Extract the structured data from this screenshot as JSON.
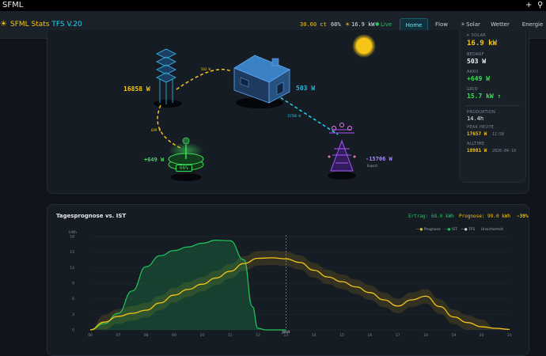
{
  "window": {
    "title": "SFML",
    "plus": "+",
    "search_glyph": "⚲"
  },
  "nav": {
    "brand_a": "SFML Stats",
    "brand_b": "TFS V.20",
    "price": "30.60 ct",
    "percent": "66%",
    "solar_now": "16.9 kW",
    "live": "Live",
    "items": [
      "Home",
      "Flow",
      "Solar",
      "Wetter",
      "Energie"
    ]
  },
  "flow": {
    "solar_panel": "16858 W",
    "house": "503 W",
    "grid": "-15706 W",
    "grid_sub": "Export",
    "battery": "+649 W",
    "battery_soc": "66%",
    "line_solar_house": "503 W",
    "line_house_grid": "15706 W",
    "line_solar_batt": "649 W"
  },
  "stats": {
    "solar_label": "SOLAR",
    "solar_value": "16.9 kW",
    "bedarf_label": "BEDARF",
    "bedarf_value": "503 W",
    "akku_label": "AKKU",
    "akku_value": "+649 W",
    "grid_label": "GRID",
    "grid_value": "15.7 kW ↑",
    "prod_label": "PRODUKTION",
    "prod_value": "14.4h",
    "peak_label": "PEAK HEUTE",
    "peak_value": "17657 W",
    "peak_time": "11:58",
    "alltime_label": "ALLTIME",
    "alltime_value": "18981 W",
    "alltime_date": "2026-04-19"
  },
  "forecast": {
    "title": "Tagesprognose vs. IST",
    "ertrag": "Ertrag: 68.0 kWh",
    "prognose": "Prognose: 99.0 kWh",
    "delta": "-39%",
    "legend": [
      "Prognose",
      "IST",
      "TFS",
      "Unsicherheit"
    ]
  },
  "colors": {
    "solar": "#f5c518",
    "house": "#22b8e6",
    "battery": "#3ddc5a",
    "grid": "#a78bfa",
    "prognose": "#f5c518",
    "ist": "#22c55e"
  },
  "chart_data": {
    "type": "line",
    "ylabel": "kWh",
    "ylim": [
      0,
      18
    ],
    "y_ticks": [
      "0",
      "3",
      "6",
      "9",
      "12",
      "15",
      "18"
    ],
    "x_ticks": [
      "06",
      "07",
      "08",
      "09",
      "10",
      "11",
      "12",
      "13",
      "14",
      "15",
      "16",
      "17",
      "18",
      "19",
      "20",
      "21"
    ],
    "now_marker": {
      "x": 13.0,
      "label": "Jetzt"
    },
    "series": [
      {
        "name": "Prognose",
        "x": [
          6,
          6.5,
          7,
          7.5,
          8,
          8.5,
          9,
          9.5,
          10,
          10.5,
          11,
          11.5,
          12,
          12.5,
          13,
          13.5,
          14,
          14.5,
          15,
          15.5,
          16,
          16.5,
          17,
          17.5,
          18,
          18.5,
          19,
          19.5,
          20,
          20.5,
          21
        ],
        "y": [
          0,
          1.5,
          2.6,
          3.2,
          3.8,
          5.2,
          6.7,
          7.8,
          8.8,
          10,
          11.3,
          12.8,
          13.8,
          13.9,
          13.7,
          13.0,
          11.5,
          10.2,
          9.3,
          8.3,
          7.2,
          5.8,
          4.6,
          5.8,
          6.5,
          4.5,
          2.5,
          1.4,
          0.6,
          0.3,
          0.1
        ]
      },
      {
        "name": "IST",
        "x": [
          6,
          6.5,
          7,
          7.5,
          8,
          8.5,
          9,
          9.5,
          10,
          10.5,
          11,
          11.5,
          11.8,
          12,
          12.3,
          12.6,
          13
        ],
        "y": [
          0,
          1.2,
          3.2,
          7.5,
          12.2,
          14.3,
          15.3,
          16.0,
          16.7,
          17.3,
          17.2,
          13.5,
          4.5,
          0.3,
          0,
          0,
          0
        ]
      }
    ],
    "uncertainty_halfwidth": 1.4
  }
}
